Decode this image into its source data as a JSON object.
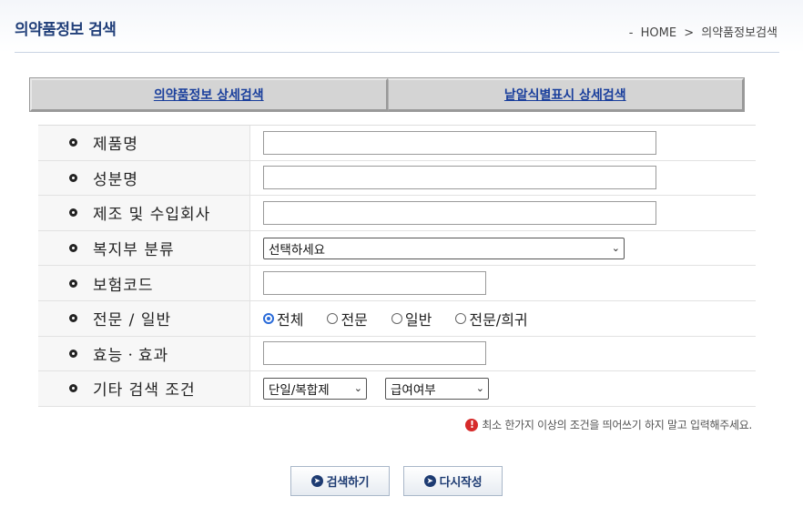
{
  "header": {
    "title": "의약품정보 검색",
    "breadcrumb_prefix": "-",
    "breadcrumb_home": "HOME",
    "breadcrumb_sep": ">",
    "breadcrumb_current": "의약품정보검색"
  },
  "tabs": [
    {
      "label": "의약품정보 상세검색"
    },
    {
      "label": "낱알식별표시 상세검색"
    }
  ],
  "form": {
    "product_name": {
      "label": "제품명",
      "value": ""
    },
    "ingredient": {
      "label": "성분명",
      "value": ""
    },
    "company": {
      "label": "제조 및 수입회사",
      "value": ""
    },
    "category": {
      "label": "복지부 분류",
      "selected": "선택하세요"
    },
    "insurance_code": {
      "label": "보험코드",
      "value": ""
    },
    "type": {
      "label": "전문 / 일반",
      "options": [
        "전체",
        "전문",
        "일반",
        "전문/희귀"
      ],
      "selected": "전체"
    },
    "efficacy": {
      "label": "효능ㆍ효과",
      "value": ""
    },
    "other": {
      "label": "기타 검색 조건",
      "select1": "단일/복합제",
      "select2": "급여여부"
    }
  },
  "notice": {
    "icon": "!",
    "text": "최소 한가지 이상의 조건을 띄어쓰기 하지 말고 입력해주세요."
  },
  "buttons": {
    "search": "검색하기",
    "reset": "다시작성"
  },
  "colors": {
    "title": "#22407a",
    "tab_text": "#1a3f9c",
    "radio_accent": "#2a6bd9",
    "notice_icon": "#d62a2a"
  }
}
